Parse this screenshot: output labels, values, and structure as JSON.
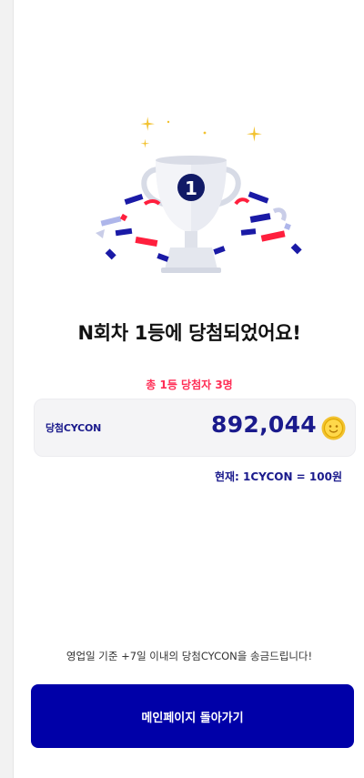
{
  "result": {
    "headline": "N회차 1등에 당첨되었어요!",
    "rank_badge": "1",
    "winners_text": "총 1등 당첨자 3명"
  },
  "prize_card": {
    "label": "당첨CYCON",
    "amount": "892,044",
    "coin_icon": "cycon-coin-icon"
  },
  "exchange_rate": "현재: 1CYCON = 100원",
  "notice": "영업일 기준 +7일 이내의 당첨CYCON을 송금드립니다!",
  "main_button_label": "메인페이지 돌아가기",
  "colors": {
    "primary_navy": "#1a1a8c",
    "button_blue": "#0000a8",
    "accent_red": "#ff2d55",
    "confetti_red": "#ff1f3d",
    "confetti_blue": "#1a1aa6",
    "star_gold": "#f2c230"
  }
}
